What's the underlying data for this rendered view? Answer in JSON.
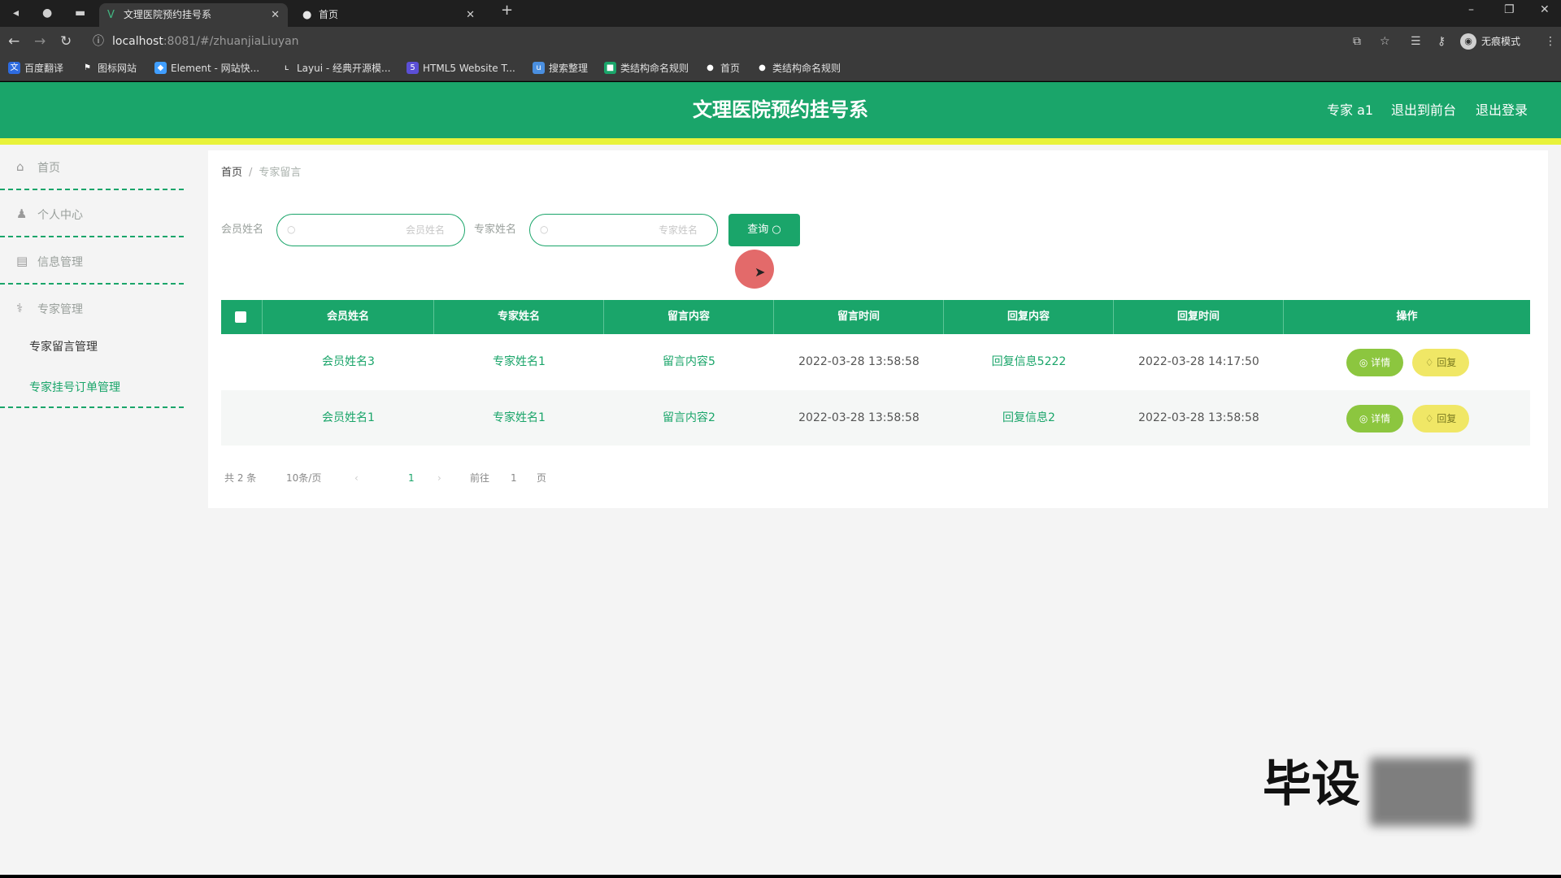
{
  "browser": {
    "tabs": [
      {
        "title": "文理医院预约挂号系",
        "favicon": "vue-icon",
        "active": true
      },
      {
        "title": "首页",
        "favicon": "globe-icon",
        "active": false
      }
    ],
    "new_tab_label": "+",
    "url_host": "localhost",
    "url_path": ":8081/#/zhuanjiaLiuyan",
    "profile_label": "无痕模式",
    "bookmarks": [
      {
        "label": "百度翻译",
        "icon": "translate-icon",
        "color": "#2d6be0"
      },
      {
        "label": "图标网站",
        "icon": "flag-icon",
        "color": "#3a3a3a"
      },
      {
        "label": "Element - 网站快...",
        "icon": "element-icon",
        "color": "#409eff"
      },
      {
        "label": "Layui - 经典开源模...",
        "icon": "layui-icon",
        "color": "#3a3a3a"
      },
      {
        "label": "HTML5 Website T...",
        "icon": "html5-icon",
        "color": "#5b4fd6"
      },
      {
        "label": "搜索整理",
        "icon": "bookmark-icon",
        "color": "#4a8fe0"
      },
      {
        "label": "类结构命名规则",
        "icon": "green-icon",
        "color": "#1aa56a"
      },
      {
        "label": "首页",
        "icon": "globe-icon",
        "color": "#3a3a3a"
      },
      {
        "label": "类结构命名规则",
        "icon": "globe-icon",
        "color": "#3a3a3a"
      }
    ]
  },
  "header": {
    "title": "文理医院预约挂号系",
    "user_label": "专家 a1",
    "back_label": "退出到前台",
    "logout_label": "退出登录"
  },
  "sidebar": {
    "items": [
      {
        "label": "首页",
        "icon": "home-icon"
      },
      {
        "label": "个人中心",
        "icon": "user-icon"
      },
      {
        "label": "信息管理",
        "icon": "message-icon"
      },
      {
        "label": "专家管理",
        "icon": "expert-icon"
      }
    ],
    "submenu": [
      {
        "label": "专家留言管理",
        "active": true
      },
      {
        "label": "专家挂号订单管理",
        "active": false
      }
    ]
  },
  "breadcrumb": {
    "home": "首页",
    "separator": "/",
    "current": "专家留言"
  },
  "search": {
    "member_label": "会员姓名",
    "member_placeholder": "会员姓名",
    "expert_label": "专家姓名",
    "expert_placeholder": "专家姓名",
    "query_label": "查询 ○"
  },
  "table": {
    "columns": [
      "会员姓名",
      "专家姓名",
      "留言内容",
      "留言时间",
      "回复内容",
      "回复时间",
      "操作"
    ],
    "rows": [
      {
        "member": "会员姓名3",
        "expert": "专家姓名1",
        "content": "留言内容5",
        "time": "2022-03-28 13:58:58",
        "reply": "回复信息5222",
        "reply_time": "2022-03-28 14:17:50",
        "detail": "◎ 详情",
        "reply_btn": "♢ 回复"
      },
      {
        "member": "会员姓名1",
        "expert": "专家姓名1",
        "content": "留言内容2",
        "time": "2022-03-28 13:58:58",
        "reply": "回复信息2",
        "reply_time": "2022-03-28 13:58:58",
        "detail": "◎ 详情",
        "reply_btn": "♢ 回复"
      }
    ]
  },
  "pagination": {
    "total": "共 2 条",
    "page_size": "10条/页",
    "prev": "‹",
    "page": "1",
    "next": "›",
    "goto": "前往",
    "goto_value": "1",
    "unit": "页"
  },
  "watermark": "毕设",
  "colors": {
    "primary": "#1aa56a",
    "stripe": "#e8f23a",
    "detail_button": "#8cc63f",
    "reply_button": "#f0e766"
  }
}
